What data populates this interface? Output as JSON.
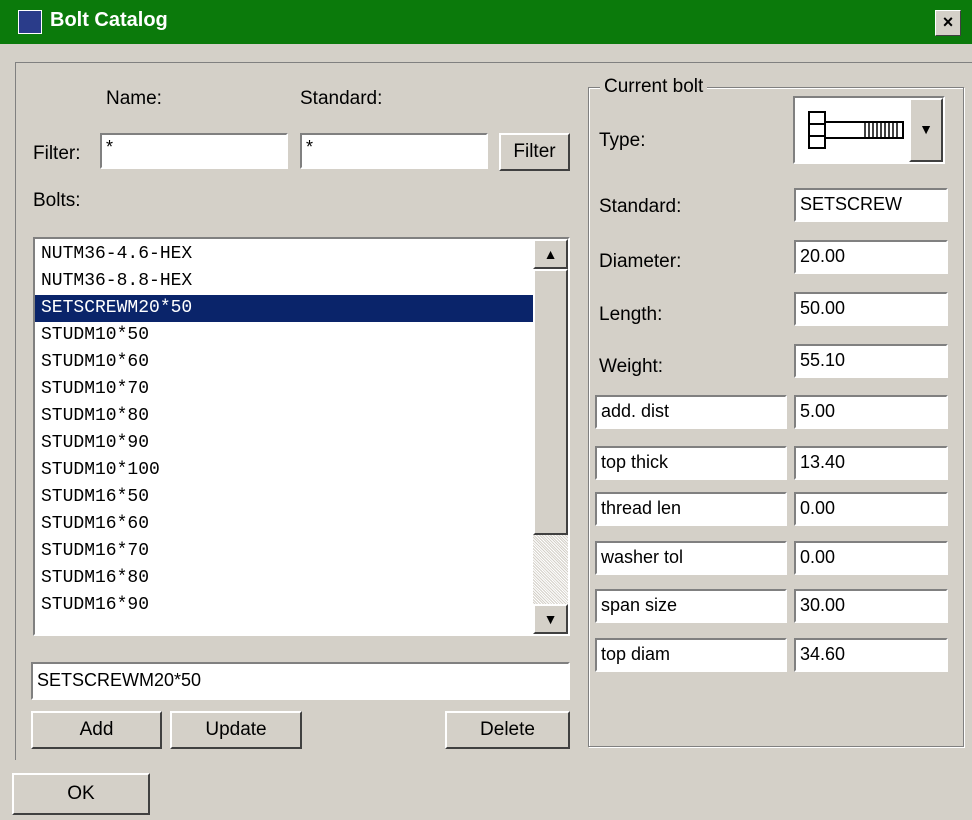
{
  "window": {
    "title": "Bolt Catalog",
    "close_label": "×"
  },
  "filter": {
    "name_header": "Name:",
    "standard_header": "Standard:",
    "filter_label": "Filter:",
    "name_value": "*",
    "standard_value": "*",
    "filter_button": "Filter"
  },
  "bolts": {
    "label": "Bolts:",
    "items": [
      "NUTM36-4.6-HEX",
      "NUTM36-8.8-HEX",
      "SETSCREWM20*50",
      "STUDM10*50",
      "STUDM10*60",
      "STUDM10*70",
      "STUDM10*80",
      "STUDM10*90",
      "STUDM10*100",
      "STUDM16*50",
      "STUDM16*60",
      "STUDM16*70",
      "STUDM16*80",
      "STUDM16*90"
    ],
    "selected": "SETSCREWM20*50",
    "scroll_up": "▲",
    "scroll_down": "▼",
    "edit_value": "SETSCREWM20*50",
    "add_button": "Add",
    "update_button": "Update",
    "delete_button": "Delete"
  },
  "current_bolt": {
    "legend": "Current bolt",
    "type_label": "Type:",
    "type_icon": "bolt-icon",
    "combo_arrow": "▼",
    "standard_label": "Standard:",
    "standard_value": "SETSCREW",
    "diameter_label": "Diameter:",
    "diameter_value": "20.00",
    "length_label": "Length:",
    "length_value": "50.00",
    "weight_label": "Weight:",
    "weight_value": "55.10",
    "properties": [
      {
        "name": "add. dist",
        "value": "5.00"
      },
      {
        "name": "top thick",
        "value": "13.40"
      },
      {
        "name": "thread len",
        "value": "0.00"
      },
      {
        "name": "washer tol",
        "value": "0.00"
      },
      {
        "name": "span size",
        "value": "30.00"
      },
      {
        "name": "top diam",
        "value": "34.60"
      }
    ]
  },
  "footer": {
    "ok_button": "OK"
  },
  "colors": {
    "title_bar": "#0b7a0b",
    "selection": "#0a246a",
    "face": "#d4d0c8"
  }
}
